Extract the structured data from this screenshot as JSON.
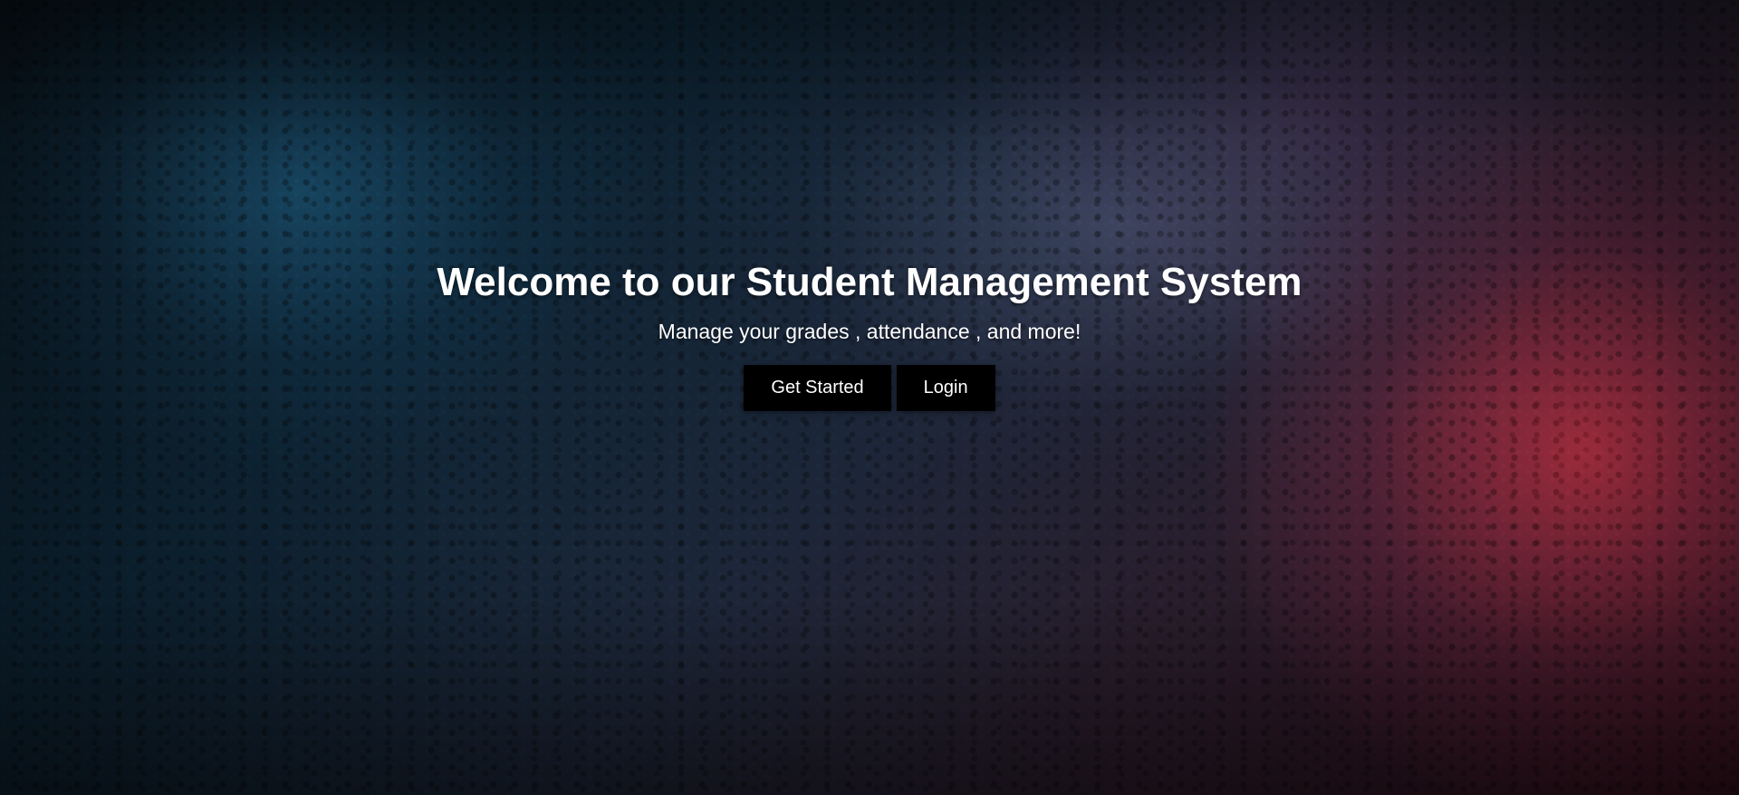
{
  "hero": {
    "title": "Welcome to our Student Management System",
    "subtitle": "Manage your grades , attendance , and more!",
    "buttons": {
      "get_started": "Get Started",
      "login": "Login"
    }
  },
  "colors": {
    "text": "#ffffff",
    "button_background": "#000000",
    "accent_blue": "#1e5a7d",
    "accent_red": "#d2374b"
  }
}
